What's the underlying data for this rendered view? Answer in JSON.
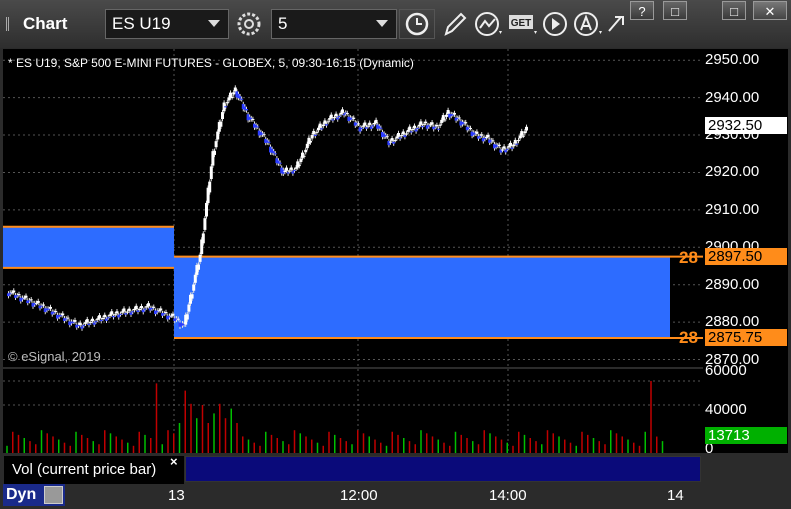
{
  "titlebar": {
    "title": "Chart",
    "symbol": "ES U19",
    "interval": "5",
    "window_buttons": [
      "?",
      "□",
      "□",
      "✕"
    ]
  },
  "chart": {
    "symbol_line": "* ES U19, S&P 500 E-MINI FUTURES - GLOBEX, 5, 09:30-16:15 (Dynamic)",
    "copyright": "© eSignal, 2019",
    "y_ticks": [
      "2950.00",
      "2940.00",
      "2930.00",
      "2920.00",
      "2910.00",
      "2900.00",
      "2890.00",
      "2880.00",
      "2870.00"
    ],
    "current_price": "2932.50",
    "level_high": "2897.50",
    "level_low": "2875.75",
    "level_tag": "28",
    "accent_level_color": "#ff8c1a",
    "zone_color": "#2d6cff"
  },
  "volume": {
    "y_ticks": [
      "60000",
      "40000",
      "0"
    ],
    "current_value": "13713",
    "current_color": "#00b000"
  },
  "study": {
    "label": "Vol (current price bar)",
    "close": "×"
  },
  "status": {
    "mode": "Dyn",
    "x_ticks": [
      "13",
      "12:00",
      "14:00",
      "14"
    ]
  },
  "chart_data": {
    "type": "candlestick",
    "ylim": [
      2868,
      2953
    ],
    "y_ticks": [
      2950,
      2940,
      2930,
      2920,
      2910,
      2900,
      2890,
      2880,
      2870
    ],
    "last_price": 2932.5,
    "levels": [
      2897.5,
      2875.75
    ],
    "volume_ylim": [
      0,
      70000
    ],
    "volume_last": 13713
  }
}
